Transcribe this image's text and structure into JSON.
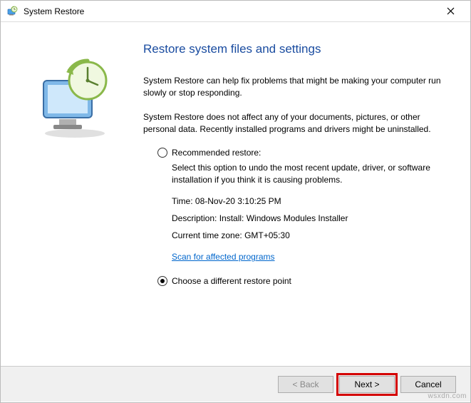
{
  "window": {
    "title": "System Restore"
  },
  "heading": "Restore system files and settings",
  "intro1": "System Restore can help fix problems that might be making your computer run slowly or stop responding.",
  "intro2": "System Restore does not affect any of your documents, pictures, or other personal data. Recently installed programs and drivers might be uninstalled.",
  "options": {
    "recommended": {
      "label": "Recommended restore:",
      "description": "Select this option to undo the most recent update, driver, or software installation if you think it is causing problems.",
      "time_label": "Time:",
      "time_value": "08-Nov-20 3:10:25 PM",
      "desc_label": "Description:",
      "desc_value": "Install: Windows Modules Installer",
      "tz_label": "Current time zone:",
      "tz_value": "GMT+05:30",
      "scan_link": "Scan for affected programs"
    },
    "different": {
      "label": "Choose a different restore point"
    }
  },
  "buttons": {
    "back": "< Back",
    "next": "Next >",
    "cancel": "Cancel"
  },
  "watermark": "wsxdn.com"
}
